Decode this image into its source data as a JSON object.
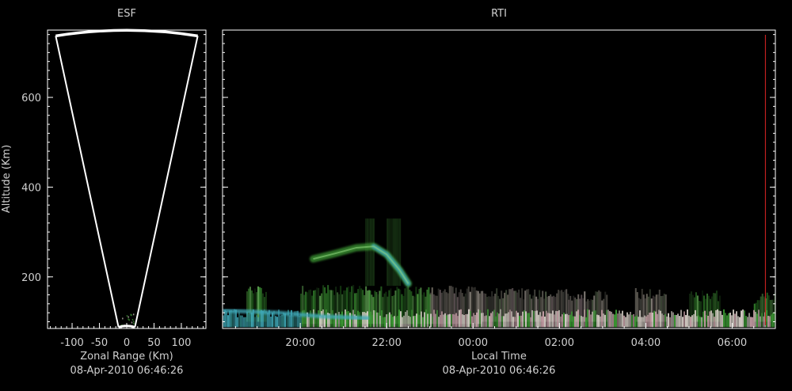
{
  "colors": {
    "background": "#000000",
    "axis": "#ffffff",
    "text": "#d0d0d0",
    "fan_outline": "#ffffff",
    "time_marker": "#c02020",
    "echo_green": "#3c9a34",
    "echo_cyan": "#3fa9b8",
    "echo_white": "#d8d0c8",
    "echo_pink": "#c8a0a8"
  },
  "chart_data": [
    {
      "id": "esf",
      "type": "heatmap",
      "title": "ESF",
      "xlabel": "Zonal Range (Km)",
      "ylabel": "Altitude (Km)",
      "footer": "08-Apr-2010 06:46:26",
      "xlim": [
        -145,
        145
      ],
      "ylim": [
        85,
        750
      ],
      "x_ticks": [
        -100,
        -50,
        0,
        50,
        100
      ],
      "x_tick_labels": [
        "-100",
        "-50",
        "0",
        "50",
        "100"
      ],
      "y_ticks": [
        200,
        400,
        600
      ],
      "y_tick_labels": [
        "200",
        "400",
        "600"
      ],
      "fan": {
        "apex_left": [
          -15,
          88
        ],
        "apex_right": [
          15,
          88
        ],
        "top_left": [
          -130,
          737
        ],
        "top_right": [
          130,
          737
        ],
        "top_peak": [
          0,
          748
        ]
      }
    },
    {
      "id": "rti",
      "type": "heatmap",
      "title": "RTI",
      "xlabel": "Local Time",
      "footer": "08-Apr-2010 06:46:26",
      "xlim": [
        18.2,
        7.0
      ],
      "ylim": [
        85,
        750
      ],
      "x_ticks": [
        20,
        22,
        24,
        26,
        28,
        30
      ],
      "x_tick_labels": [
        "20:00",
        "22:00",
        "00:00",
        "02:00",
        "04:00",
        "06:00"
      ],
      "y_ticks": [
        200,
        400,
        600
      ],
      "current_time_marker": 30.77,
      "echo_regions": [
        {
          "kind": "green",
          "t0": 18.75,
          "t1": 19.2,
          "a0": 100,
          "a1": 180
        },
        {
          "kind": "green",
          "t0": 20.0,
          "t1": 21.6,
          "a0": 95,
          "a1": 182
        },
        {
          "kind": "green",
          "t0": 21.6,
          "t1": 23.0,
          "a0": 95,
          "a1": 180
        },
        {
          "kind": "white",
          "t0": 23.0,
          "t1": 24.2,
          "a0": 95,
          "a1": 180
        },
        {
          "kind": "white",
          "t0": 24.2,
          "t1": 26.2,
          "a0": 100,
          "a1": 175
        },
        {
          "kind": "white",
          "t0": 26.2,
          "t1": 27.1,
          "a0": 100,
          "a1": 170
        },
        {
          "kind": "white",
          "t0": 27.75,
          "t1": 28.45,
          "a0": 100,
          "a1": 175
        },
        {
          "kind": "green",
          "t0": 29.0,
          "t1": 29.7,
          "a0": 100,
          "a1": 170
        },
        {
          "kind": "green",
          "t0": 30.5,
          "t1": 31.0,
          "a0": 100,
          "a1": 165
        }
      ],
      "plume": [
        {
          "t": 20.3,
          "a": 240
        },
        {
          "t": 20.8,
          "a": 252
        },
        {
          "t": 21.3,
          "a": 265
        },
        {
          "t": 21.7,
          "a": 268
        },
        {
          "t": 22.0,
          "a": 250
        },
        {
          "t": 22.3,
          "a": 215
        },
        {
          "t": 22.5,
          "a": 185
        }
      ]
    }
  ]
}
